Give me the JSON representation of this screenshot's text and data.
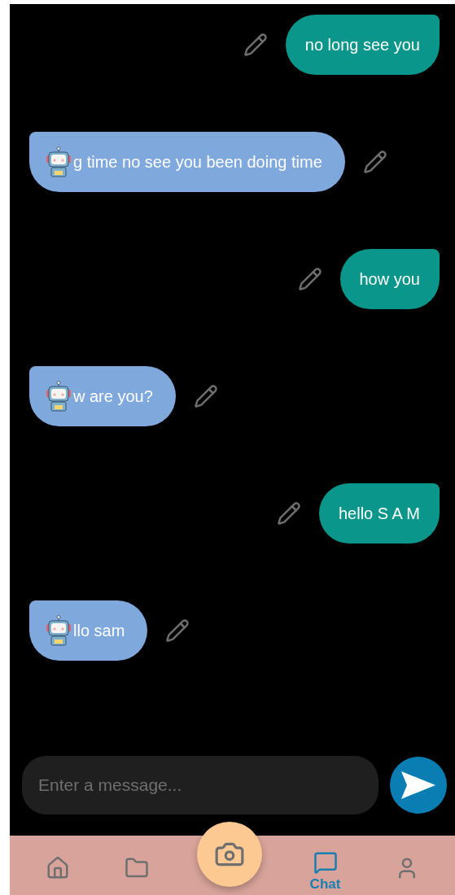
{
  "messages": [
    {
      "kind": "user",
      "text": "no long see you"
    },
    {
      "kind": "bot",
      "text": "g time no see you been doing time"
    },
    {
      "kind": "user",
      "text": "how you"
    },
    {
      "kind": "bot",
      "text": "w are you?"
    },
    {
      "kind": "user",
      "text": "hello S A M"
    },
    {
      "kind": "bot",
      "text": "llo sam"
    }
  ],
  "composer": {
    "placeholder": "Enter a message..."
  },
  "nav": [
    {
      "kind": "home",
      "selected": false
    },
    {
      "kind": "folder",
      "selected": false
    },
    {
      "kind": "camera",
      "selected": false
    },
    {
      "kind": "chat",
      "selected": true,
      "label": "Chat"
    },
    {
      "kind": "profile",
      "selected": false
    }
  ]
}
